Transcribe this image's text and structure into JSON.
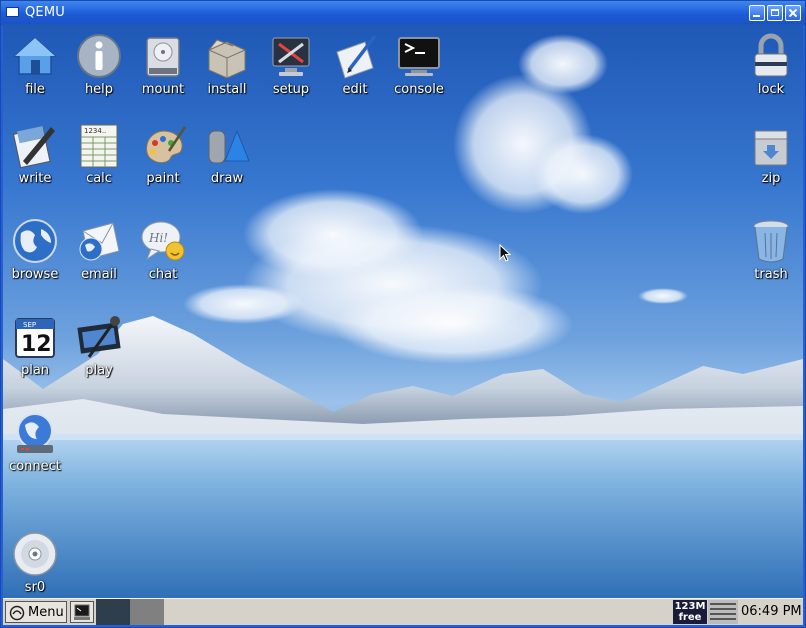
{
  "window": {
    "title": "QEMU"
  },
  "desktop_icons": [
    {
      "name": "file",
      "label": "file",
      "icon": "home-icon"
    },
    {
      "name": "help",
      "label": "help",
      "icon": "info-icon"
    },
    {
      "name": "mount",
      "label": "mount",
      "icon": "hard-drive-icon"
    },
    {
      "name": "install",
      "label": "install",
      "icon": "package-box-icon"
    },
    {
      "name": "setup",
      "label": "setup",
      "icon": "settings-tools-icon"
    },
    {
      "name": "edit",
      "label": "edit",
      "icon": "pen-paper-icon"
    },
    {
      "name": "console",
      "label": "console",
      "icon": "terminal-icon"
    },
    {
      "name": "write",
      "label": "write",
      "icon": "word-processor-icon"
    },
    {
      "name": "calc",
      "label": "calc",
      "icon": "spreadsheet-icon"
    },
    {
      "name": "paint",
      "label": "paint",
      "icon": "palette-icon"
    },
    {
      "name": "draw",
      "label": "draw",
      "icon": "shapes-icon"
    },
    {
      "name": "browse",
      "label": "browse",
      "icon": "globe-icon"
    },
    {
      "name": "email",
      "label": "email",
      "icon": "envelope-globe-icon"
    },
    {
      "name": "chat",
      "label": "chat",
      "icon": "chat-bubble-icon",
      "text": "Hi!"
    },
    {
      "name": "plan",
      "label": "plan",
      "icon": "calendar-icon",
      "month": "SEP",
      "day": "12"
    },
    {
      "name": "play",
      "label": "play",
      "icon": "film-microphone-icon"
    },
    {
      "name": "connect",
      "label": "connect",
      "icon": "network-globe-icon"
    },
    {
      "name": "sr0",
      "label": "sr0",
      "icon": "optical-disc-icon"
    },
    {
      "name": "lock",
      "label": "lock",
      "icon": "padlock-icon"
    },
    {
      "name": "zip",
      "label": "zip",
      "icon": "archive-box-icon"
    },
    {
      "name": "trash",
      "label": "trash",
      "icon": "trash-can-icon"
    }
  ],
  "taskbar": {
    "menu_label": "Menu",
    "memory_line1": "123M",
    "memory_line2": "free",
    "clock": "06:49 PM"
  },
  "colors": {
    "titlebar": "#1c5bd6",
    "taskbar": "#d6d2c9",
    "workspace_active": "#2f3e4d",
    "workspace_inactive": "#808080"
  }
}
